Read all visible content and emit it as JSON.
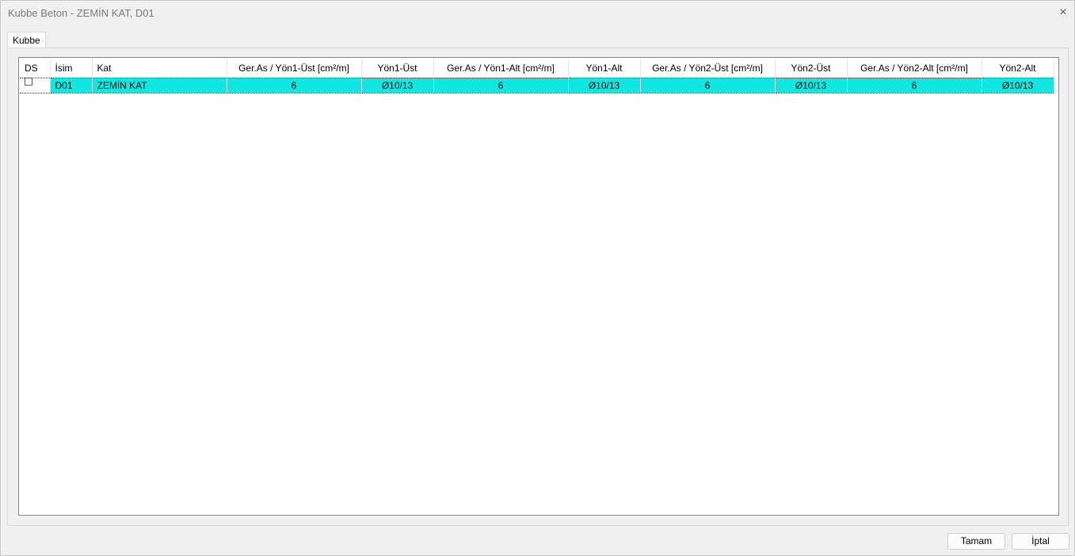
{
  "window": {
    "title": "Kubbe Beton - ZEMİN KAT, D01",
    "close_icon": "×"
  },
  "tabs": [
    {
      "label": "Kubbe"
    }
  ],
  "table": {
    "columns": [
      "DS",
      "İsim",
      "Kat",
      "Ger.As / Yön1-Üst [cm²/m]",
      "Yön1-Üst",
      "Ger.As / Yön1-Alt [cm²/m]",
      "Yön1-Alt",
      "Ger.As / Yön2-Üst [cm²/m]",
      "Yön2-Üst",
      "Ger.As / Yön2-Alt [cm²/m]",
      "Yön2-Alt"
    ],
    "rows": [
      {
        "ds": false,
        "cells": [
          "D01",
          "ZEMİN KAT",
          "6",
          "Ø10/13",
          "6",
          "Ø10/13",
          "6",
          "Ø10/13",
          "6",
          "Ø10/13"
        ]
      }
    ],
    "selected_color": "#12e6e0"
  },
  "buttons": {
    "ok": "Tamam",
    "cancel": "İptal"
  }
}
